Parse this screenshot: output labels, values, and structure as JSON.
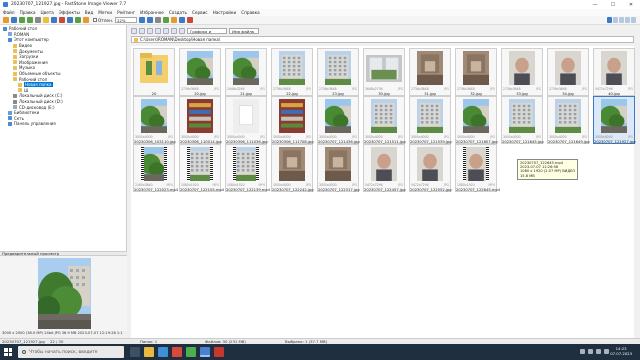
{
  "window": {
    "title": "20230707_121927.jpg - FastStone Image Viewer 7.7",
    "controls": [
      "—",
      "☐",
      "✕"
    ]
  },
  "menu": [
    "Файл",
    "Правка",
    "Цвета",
    "Эффекты",
    "Вид",
    "Метки",
    "Рейтинг",
    "Избранное",
    "Создать",
    "Сервис",
    "Настройки",
    "Справка"
  ],
  "toolbar": {
    "show_label": "Отлен.",
    "zoom_value": "22%",
    "filter_value": "Графика и видео",
    "sort_value": "Имя файла"
  },
  "address": "C:\\Users\\ROMAN\\Desktop\\Новая папка\\",
  "tree": [
    {
      "label": "Рабочий стол",
      "icon": "pc",
      "indent": 0
    },
    {
      "label": "ROMAN",
      "icon": "usr",
      "indent": 1
    },
    {
      "label": "Этот компьютер",
      "icon": "pc",
      "indent": 1
    },
    {
      "label": "Видео",
      "icon": "fd",
      "indent": 2
    },
    {
      "label": "Документы",
      "icon": "fd",
      "indent": 2
    },
    {
      "label": "Загрузки",
      "icon": "fd",
      "indent": 2
    },
    {
      "label": "Изображения",
      "icon": "fd",
      "indent": 2
    },
    {
      "label": "Музыка",
      "icon": "fd",
      "indent": 2
    },
    {
      "label": "Объемные объекты",
      "icon": "fd",
      "indent": 2
    },
    {
      "label": "Рабочий стол",
      "icon": "fd",
      "indent": 2
    },
    {
      "label": "Новая папка",
      "icon": "fd",
      "indent": 3,
      "selected": true
    },
    {
      "label": "Ш",
      "icon": "fd",
      "indent": 3
    },
    {
      "label": "Локальный диск (C:)",
      "icon": "dk",
      "indent": 2
    },
    {
      "label": "Локальный диск (D:)",
      "icon": "dk",
      "indent": 2
    },
    {
      "label": "CD-дисковод (E:)",
      "icon": "cd",
      "indent": 2
    },
    {
      "label": "Библиотеки",
      "icon": "lib",
      "indent": 1
    },
    {
      "label": "Сеть",
      "icon": "net",
      "indent": 1
    },
    {
      "label": "Панель управления",
      "icon": "pc",
      "indent": 1
    }
  ],
  "preview": {
    "label": "Предварительный просмотр",
    "info": "3000 x 2000 (38.0 MP)  24bit  JPG  36.9 MB  2023-07-07 12:19:28  1:1"
  },
  "thumbnails": [
    {
      "name": "20",
      "dims": "",
      "ext": "",
      "kind": "folder"
    },
    {
      "name": "20.jpg",
      "dims": "2736x3648",
      "ext": "JPG",
      "kind": "photo-tree"
    },
    {
      "name": "21.jpg",
      "dims": "2448x3264",
      "ext": "JPG",
      "kind": "photo-tree"
    },
    {
      "name": "22.jpg",
      "dims": "2736x3648",
      "ext": "JPG",
      "kind": "photo-building"
    },
    {
      "name": "23.jpg",
      "dims": "2736x3648",
      "ext": "JPG",
      "kind": "photo-building"
    },
    {
      "name": "30.jpg",
      "dims": "3648x2736",
      "ext": "JPG",
      "kind": "photo-window"
    },
    {
      "name": "31.jpg",
      "dims": "2736x3648",
      "ext": "JPG",
      "kind": "photo-room"
    },
    {
      "name": "32.jpg",
      "dims": "2736x3648",
      "ext": "JPG",
      "kind": "photo-room"
    },
    {
      "name": "33.jpg",
      "dims": "2736x3648",
      "ext": "JPG",
      "kind": "photo-face"
    },
    {
      "name": "34.jpg",
      "dims": "2736x3648",
      "ext": "JPG",
      "kind": "photo-face"
    },
    {
      "name": "40.jpg",
      "dims": "5472x7296",
      "ext": "JPG",
      "kind": "photo-face"
    },
    {
      "name": "20230306_103110.jpg",
      "dims": "3000x4000",
      "ext": "JPG",
      "kind": "photo-tree"
    },
    {
      "name": "20230306_110014.jpg",
      "dims": "3000x4000",
      "ext": "JPG",
      "kind": "photo-shelf"
    },
    {
      "name": "20230306_111036.jpg",
      "dims": "3000x4000",
      "ext": "JPG",
      "kind": "photo-white"
    },
    {
      "name": "20230306_111708.jpg",
      "dims": "3000x4000",
      "ext": "JPG",
      "kind": "photo-shelf"
    },
    {
      "name": "20230707_121436.jpg",
      "dims": "3000x4000",
      "ext": "JPG",
      "kind": "photo-tree"
    },
    {
      "name": "20230707_121511.jpg",
      "dims": "3000x4000",
      "ext": "JPG",
      "kind": "photo-building"
    },
    {
      "name": "20230707_121539.jpg",
      "dims": "3000x4000",
      "ext": "JPG",
      "kind": "photo-building"
    },
    {
      "name": "20230707_121607.jpg",
      "dims": "3000x4000",
      "ext": "JPG",
      "kind": "photo-tree"
    },
    {
      "name": "20230707_121645.jpg",
      "dims": "3000x4000",
      "ext": "JPG",
      "kind": "photo-building"
    },
    {
      "name": "20230707_121649.jpg",
      "dims": "3000x4000",
      "ext": "JPG",
      "kind": "photo-building"
    },
    {
      "name": "20230707_121927.jpg",
      "dims": "3000x4000",
      "ext": "JPG",
      "kind": "photo-tree",
      "selected": true
    },
    {
      "name": "20230707_122023.mp4",
      "dims": "2160x3840",
      "ext": "MP4",
      "kind": "video-tree"
    },
    {
      "name": "20230707_122105.mp4",
      "dims": "1080x1920",
      "ext": "MP4",
      "kind": "video-building"
    },
    {
      "name": "20230707_122139.mp4",
      "dims": "1080x1920",
      "ext": "MP4",
      "kind": "video-building"
    },
    {
      "name": "20230707_122242.jpg",
      "dims": "3000x4000",
      "ext": "JPG",
      "kind": "photo-room"
    },
    {
      "name": "20230707_122317.jpg",
      "dims": "3000x4000",
      "ext": "JPG",
      "kind": "photo-room"
    },
    {
      "name": "20230707_122457.jpg",
      "dims": "5472x7296",
      "ext": "JPG",
      "kind": "photo-face"
    },
    {
      "name": "20230707_122552.jpg",
      "dims": "5472x7296",
      "ext": "JPG",
      "kind": "photo-face"
    },
    {
      "name": "20230707_122645.mp4",
      "dims": "1080x1920",
      "ext": "MP4",
      "kind": "video-face"
    }
  ],
  "tooltip": {
    "lines": [
      "20230707_122645.mp4",
      "2023-07-07 12:26:56",
      "1080 x 1920 (2.07 MP)  ВИДЕО",
      "15.8 MB"
    ]
  },
  "status": {
    "folders": "Папок: 1",
    "files": "Файлов: 30 (231 MB)",
    "selected": "Выбрано: 1 (37.7 MB)",
    "filename": "20230707_121927.jpg",
    "counter": "22 / 30",
    "right_info": "Ч"
  },
  "taskbar": {
    "search_placeholder": "Чтобы начать поиск, введите",
    "time": "14:23",
    "date": "07.07.2023"
  }
}
